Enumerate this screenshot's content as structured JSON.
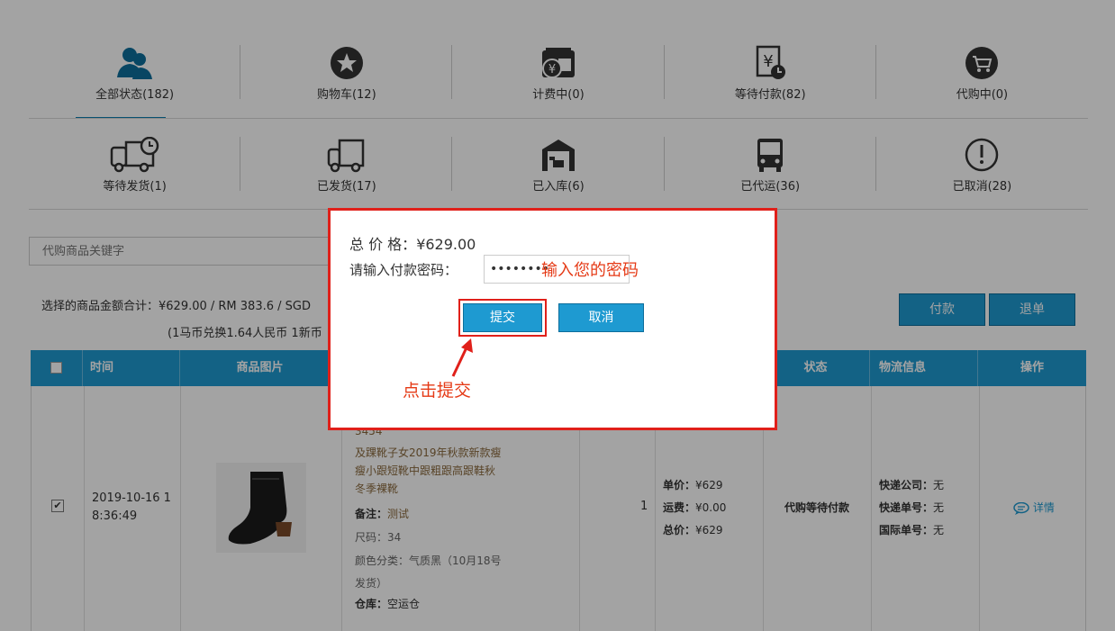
{
  "statuses_row1": [
    {
      "label": "全部状态(182)",
      "icon": "users-icon"
    },
    {
      "label": "购物车(12)",
      "icon": "star-icon"
    },
    {
      "label": "计费中(0)",
      "icon": "yen-wallet-icon"
    },
    {
      "label": "等待付款(82)",
      "icon": "yen-clock-icon"
    },
    {
      "label": "代购中(0)",
      "icon": "cart-icon"
    }
  ],
  "statuses_row2": [
    {
      "label": "等待发货(1)",
      "icon": "truck-clock-icon"
    },
    {
      "label": "已发货(17)",
      "icon": "truck-icon"
    },
    {
      "label": "已入库(6)",
      "icon": "warehouse-icon"
    },
    {
      "label": "已代运(36)",
      "icon": "bus-icon"
    },
    {
      "label": "已取消(28)",
      "icon": "alert-icon"
    }
  ],
  "search": {
    "placeholder": "代购商品关键字"
  },
  "summary": {
    "line1": "选择的商品金额合计：¥629.00  / RM 383.6  / SGD",
    "line2": "(1马币兑换1.64人民币 1新币"
  },
  "actions": {
    "pay": "付款",
    "refund": "退单"
  },
  "table": {
    "headers": {
      "time": "时间",
      "image": "商品图片",
      "status": "状态",
      "logistics": "物流信息",
      "ops": "操作"
    },
    "row": {
      "time": "2019-10-16 1\n8:36:49",
      "product_code": "3454",
      "product_name": "及踝靴子女2019年秋款新款瘦\n瘦小跟短靴中跟粗跟高跟鞋秋\n冬季裸靴",
      "note_label": "备注：",
      "note_value": "测试",
      "size": "尺码：34",
      "color": "颜色分类：气质黑（10月18号\n发货）",
      "warehouse_label": "仓库：",
      "warehouse_value": "空运仓",
      "quantity": "1",
      "unit_label": "单价：",
      "unit_value": "¥629",
      "ship_label": "运费：",
      "ship_value": "¥0.00",
      "total_label": "总价：",
      "total_value": "¥629",
      "status": "代购等待付款",
      "courier_label": "快递公司：",
      "courier_value": "无",
      "tracking_label": "快递单号：",
      "tracking_value": "无",
      "intl_label": "国际单号：",
      "intl_value": "无",
      "details": "详情"
    }
  },
  "modal": {
    "total_label": "总 价 格：",
    "total_value": "¥629.00",
    "password_label": "请输入付款密码：",
    "password_value": "••••••••",
    "submit": "提交",
    "cancel": "取消"
  },
  "annotations": {
    "password_hint": "输入您的密码",
    "click_hint": "点击提交"
  },
  "colors": {
    "accent": "#1e9ad1",
    "annotation_red": "#e53a16"
  }
}
